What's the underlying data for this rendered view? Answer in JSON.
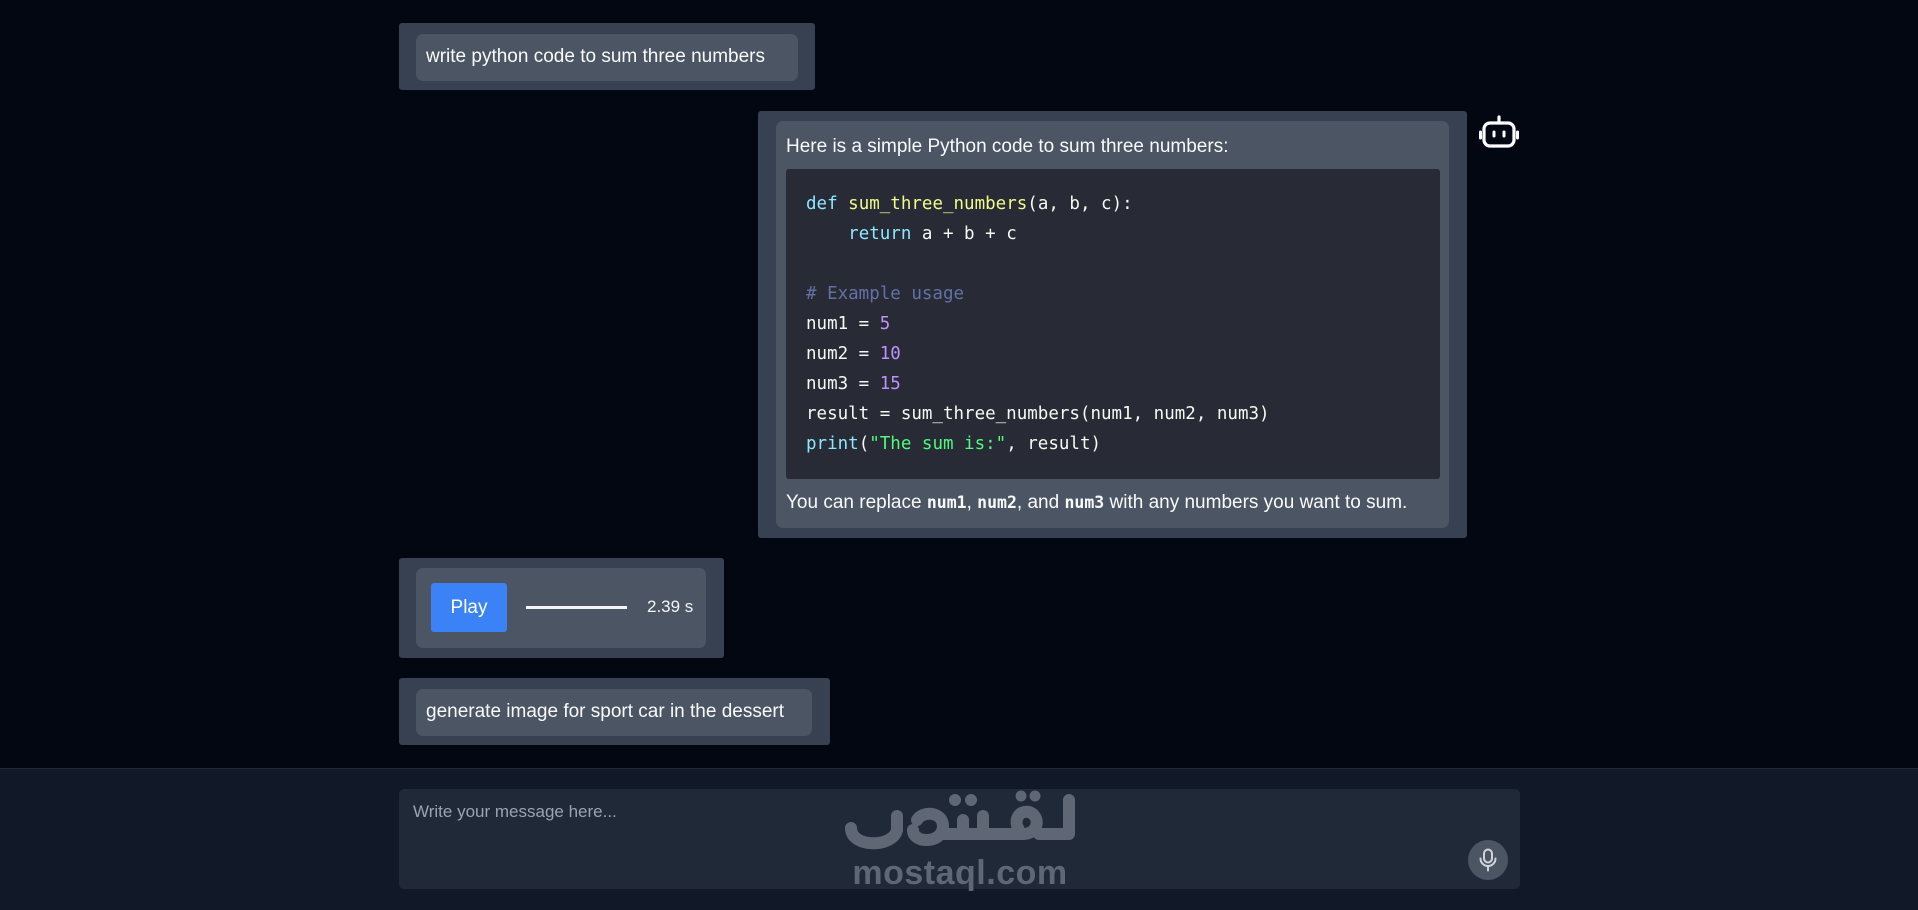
{
  "messages": {
    "user_1": {
      "text": "write python code to sum three numbers"
    },
    "assistant_1": {
      "intro": "Here is a simple Python code to sum three numbers:",
      "code": {
        "line1": {
          "kw": "def",
          "fn": "sum_three_numbers",
          "rest": "(a, b, c):"
        },
        "line2": {
          "indent": "    ",
          "kw": "return",
          "rest": " a + b + c"
        },
        "line4": {
          "comment": "# Example usage"
        },
        "line5": {
          "name": "num1 = ",
          "num": "5"
        },
        "line6": {
          "name": "num2 = ",
          "num": "10"
        },
        "line7": {
          "name": "num3 = ",
          "num": "15"
        },
        "line8": {
          "text": "result = sum_three_numbers(num1, num2, num3)"
        },
        "line9": {
          "fn": "print",
          "open": "(",
          "str": "\"The sum is:\"",
          "rest": ", result)"
        }
      },
      "outro": {
        "prefix": "You can replace ",
        "code1": "num1",
        "sep1": ", ",
        "code2": "num2",
        "sep2": ", and ",
        "code3": "num3",
        "suffix": " with any numbers you want to sum."
      }
    },
    "audio_1": {
      "play_label": "Play",
      "duration": "2.39 s",
      "progress_fraction": 1.0
    },
    "user_2": {
      "text": "generate image for sport car in the dessert"
    }
  },
  "icons": {
    "assistant_avatar": "robot-icon",
    "mic": "microphone-icon"
  },
  "composer": {
    "placeholder": "Write your message here..."
  },
  "watermark": {
    "text": "mostaql.com",
    "logo_text": "مستقل"
  },
  "colors": {
    "background": "#030712",
    "bubble_outer": "#374151",
    "bubble_inner": "#4b5563",
    "code_background": "#282a36",
    "play_button": "#3b82f6",
    "composer_background": "#1f2937"
  }
}
